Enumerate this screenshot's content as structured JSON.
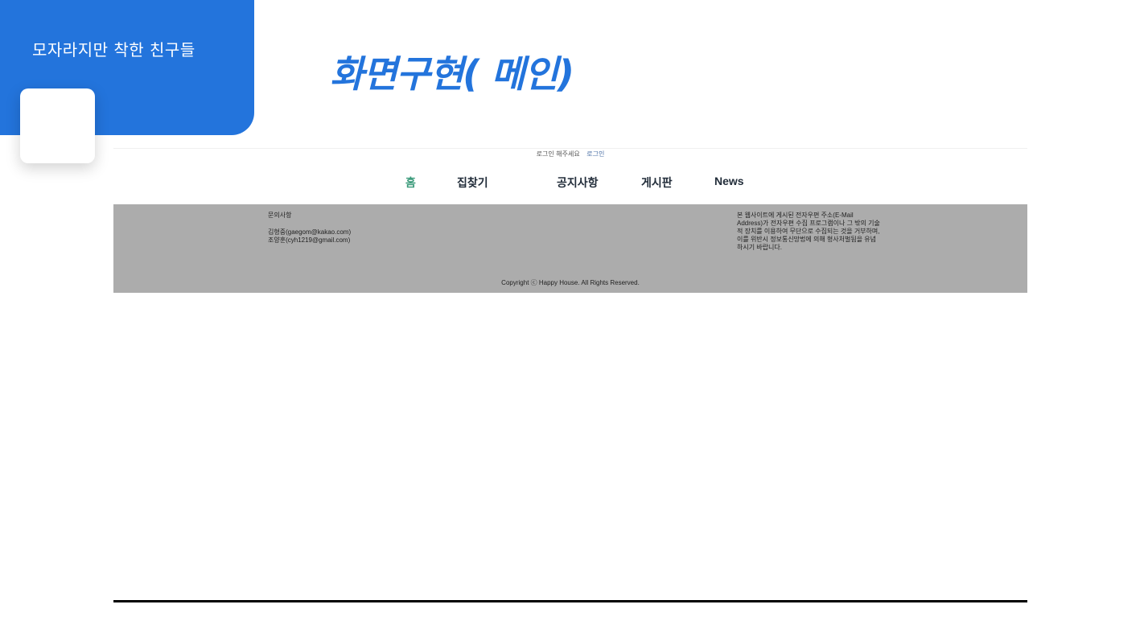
{
  "team": {
    "name": "모자라지만 착한 친구들"
  },
  "slide": {
    "title": "화면구현( 메인)"
  },
  "site": {
    "login_bar": {
      "message": "로그인 해주세요",
      "login_link": "로그인"
    },
    "nav": {
      "items": [
        {
          "label": "홈",
          "active": true
        },
        {
          "label": "집찾기",
          "active": false
        },
        {
          "label": "공지사항",
          "active": false
        },
        {
          "label": "게시판",
          "active": false
        },
        {
          "label": "News",
          "active": false
        }
      ]
    },
    "footer": {
      "contact_heading": "문의사항",
      "contacts": [
        "김형중(gaegom@kakao.com)",
        "조양훈(cyh1219@gmail.com)"
      ],
      "notice": "본 웹사이트에 게시된 전자우편 주소(E-Mail Address)가 전자우편 수집 프로그램이나 그 밖의 기술적 장치를 이용하여 무단으로 수집되는 것을 거부하며, 이를 위반시 정보통신망법에 의해 형사처벌됨을 유념하시기 바랍니다.",
      "copyright": "Copyright ⓒ Happy House. All Rights Reserved."
    }
  },
  "colors": {
    "brand_blue": "#2374dc",
    "nav_active": "#3a9a7a",
    "footer_bg": "#acacac"
  }
}
